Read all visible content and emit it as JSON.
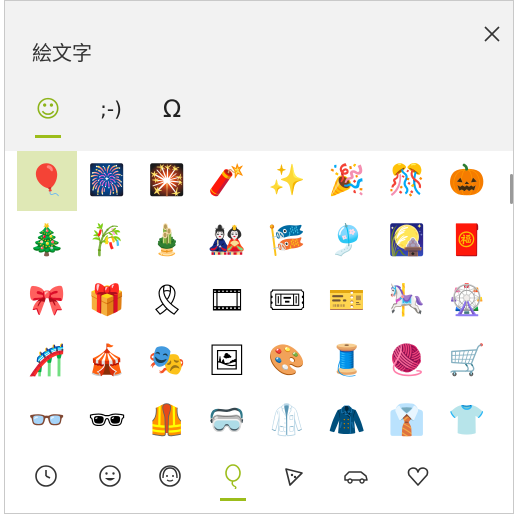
{
  "title": "絵文字",
  "close_label": "✕",
  "tabs": [
    {
      "label": "☺",
      "name": "tab-emoji"
    },
    {
      "label": ";-)",
      "name": "tab-kaomoji"
    },
    {
      "label": "Ω",
      "name": "tab-symbols"
    }
  ],
  "emoji_rows": [
    [
      "🎈",
      "🎆",
      "🎇",
      "🧨",
      "✨",
      "🎉",
      "🎊",
      "🎃"
    ],
    [
      "🎄",
      "🎋",
      "🎍",
      "🎎",
      "🎏",
      "🎐",
      "🎑",
      "🧧"
    ],
    [
      "🎀",
      "🎁",
      "🎗",
      "🎞",
      "🎟",
      "🎫",
      "🎠",
      "🎡"
    ],
    [
      "🎢",
      "🎪",
      "🎭",
      "🖼",
      "🎨",
      "🧵",
      "🧶",
      "🛒"
    ],
    [
      "👓",
      "🕶",
      "🦺",
      "🥽",
      "🥼",
      "🧥",
      "👔",
      "👕"
    ]
  ],
  "emoji_names": [
    [
      "balloon",
      "fireworks",
      "sparkler",
      "firecracker",
      "sparkles",
      "party-popper",
      "confetti-ball",
      "jack-o-lantern"
    ],
    [
      "christmas-tree",
      "tanabata-tree",
      "pine-decoration",
      "japanese-dolls",
      "carp-streamer",
      "wind-chime",
      "moon-viewing",
      "red-envelope"
    ],
    [
      "ribbon",
      "wrapped-gift",
      "reminder-ribbon",
      "film-frames",
      "admission-tickets",
      "ticket",
      "carousel-horse",
      "ferris-wheel"
    ],
    [
      "roller-coaster",
      "circus-tent",
      "performing-arts",
      "framed-picture",
      "artist-palette",
      "thread",
      "yarn",
      "shopping-cart"
    ],
    [
      "glasses",
      "sunglasses",
      "safety-vest",
      "goggles",
      "lab-coat",
      "coat",
      "necktie",
      "t-shirt"
    ]
  ],
  "selected": {
    "row": 0,
    "col": 0
  },
  "bottom_categories": [
    {
      "name": "recent-icon"
    },
    {
      "name": "smiley-icon"
    },
    {
      "name": "people-icon"
    },
    {
      "name": "celebration-icon"
    },
    {
      "name": "food-icon"
    },
    {
      "name": "travel-icon"
    },
    {
      "name": "heart-icon"
    }
  ],
  "accent_color": "#9cbd1b",
  "selected_bg": "#dfe8b5"
}
